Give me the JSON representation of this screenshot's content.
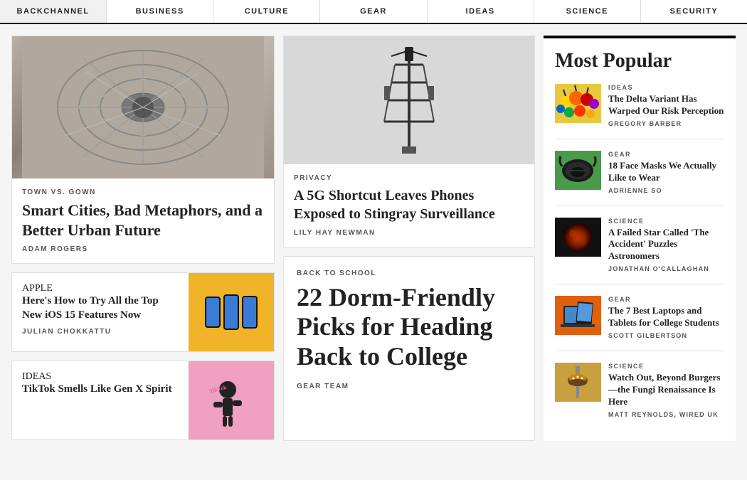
{
  "nav": {
    "items": [
      {
        "id": "backchannel",
        "label": "BACKCHANNEL"
      },
      {
        "id": "business",
        "label": "BUSINESS"
      },
      {
        "id": "culture",
        "label": "CULTURE"
      },
      {
        "id": "gear",
        "label": "GEAR"
      },
      {
        "id": "ideas",
        "label": "IDEAS"
      },
      {
        "id": "science",
        "label": "SCIENCE"
      },
      {
        "id": "security",
        "label": "SECURITY"
      }
    ]
  },
  "feature_article": {
    "category": "TOWN VS. GOWN",
    "title": "Smart Cities, Bad Metaphors, and a Better Urban Future",
    "author": "ADAM ROGERS"
  },
  "small_card_1": {
    "category": "APPLE",
    "title": "Here's How to Try All the Top New iOS 15 Features Now",
    "author": "JULIAN CHOKKATTU"
  },
  "small_card_2": {
    "category": "IDEAS",
    "title": "TikTok Smells Like Gen X Spirit",
    "author": ""
  },
  "mid_top": {
    "category": "PRIVACY",
    "title": "A 5G Shortcut Leaves Phones Exposed to Stingray Surveillance",
    "author": "LILY HAY NEWMAN"
  },
  "mid_bottom": {
    "category": "BACK TO SCHOOL",
    "title": "22 Dorm-Friendly Picks for Heading Back to College",
    "author": "GEAR TEAM"
  },
  "most_popular": {
    "heading": "Most Popular",
    "items": [
      {
        "category": "IDEAS",
        "title": "The Delta Variant Has Warped Our Risk Perception",
        "author": "GREGORY BARBER",
        "thumb_type": "ideas"
      },
      {
        "category": "GEAR",
        "title": "18 Face Masks We Actually Like to Wear",
        "author": "ADRIENNE SO",
        "thumb_type": "mask"
      },
      {
        "category": "SCIENCE",
        "title": "A Failed Star Called 'The Accident' Puzzles Astronomers",
        "author": "JONATHAN O'CALLAGHAN",
        "thumb_type": "science"
      },
      {
        "category": "GEAR",
        "title": "The 7 Best Laptops and Tablets for College Students",
        "author": "SCOTT GILBERTSON",
        "thumb_type": "laptops"
      },
      {
        "category": "SCIENCE",
        "title": "Watch Out, Beyond Burgers—the Fungi Renaissance Is Here",
        "author": "MATT REYNOLDS, WIRED UK",
        "thumb_type": "fungi"
      }
    ]
  }
}
